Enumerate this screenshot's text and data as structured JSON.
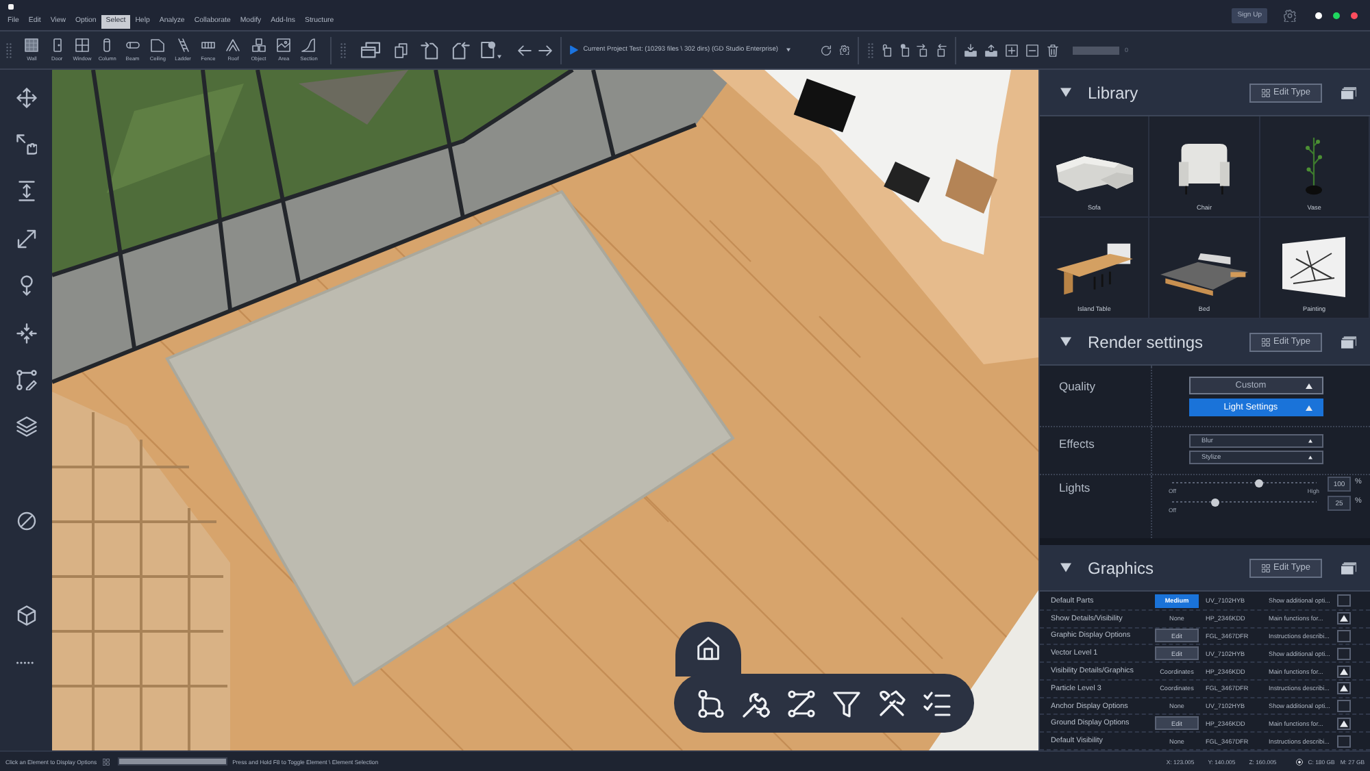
{
  "title_bar": {
    "menu": [
      {
        "label": "File",
        "selected": false
      },
      {
        "label": "Edit",
        "selected": false
      },
      {
        "label": "View",
        "selected": false
      },
      {
        "label": "Option",
        "selected": false
      },
      {
        "label": "Select",
        "selected": true
      },
      {
        "label": "Help",
        "selected": false
      },
      {
        "label": "Analyze",
        "selected": false
      },
      {
        "label": "Collaborate",
        "selected": false
      },
      {
        "label": "Modify",
        "selected": false
      },
      {
        "label": "Add-Ins",
        "selected": false
      },
      {
        "label": "Structure",
        "selected": false
      }
    ],
    "sign_up": "Sign Up",
    "window_controls": [
      {
        "color": "#ffffff"
      },
      {
        "color": "#1fd65f"
      },
      {
        "color": "#ff4d5e"
      }
    ]
  },
  "toolbar": {
    "tools": [
      "Wall",
      "Door",
      "Window",
      "Column",
      "Beam",
      "Ceiling",
      "Ladder",
      "Fence",
      "Roof",
      "Object",
      "Area",
      "Section"
    ],
    "project": "Current Project Test: (10293 files \\ 302 dirs) (GD Studio Enterprise)",
    "zoom_value": "0"
  },
  "library": {
    "title": "Library",
    "edit_type": "Edit Type",
    "items": [
      "Sofa",
      "Chair",
      "Vase",
      "Island Table",
      "Bed",
      "Painting"
    ]
  },
  "render_settings": {
    "title": "Render settings",
    "edit_type": "Edit Type",
    "quality": {
      "label": "Quality",
      "dropdown": "Custom",
      "button": "Light Settings"
    },
    "effects": {
      "label": "Effects",
      "dropdowns": [
        "Blur",
        "Stylize"
      ]
    },
    "lights": {
      "label": "Lights",
      "sliders": [
        {
          "level": 0.6,
          "min_label": "Off",
          "max_label": "High",
          "value": "100",
          "unit": "%"
        },
        {
          "level": 0.3,
          "min_label": "Off",
          "value": "25",
          "unit": "%"
        }
      ]
    }
  },
  "graphics": {
    "title": "Graphics",
    "edit_type": "Edit Type",
    "rows": [
      {
        "name": "Default Parts",
        "value": {
          "kind": "button",
          "label": "Medium",
          "selected": true
        },
        "code": "UV_7102HYB",
        "description": "Show additional opti...",
        "checked": false
      },
      {
        "name": "Show Details/Visibility",
        "value": {
          "kind": "text",
          "label": "None"
        },
        "code": "HP_2346KDD",
        "description": "Main functions for...",
        "checked": true
      },
      {
        "name": "Graphic Display Options",
        "value": {
          "kind": "button",
          "label": "Edit",
          "selected": false
        },
        "code": "FGL_3467DFR",
        "description": "Instructions describi...",
        "checked": false
      },
      {
        "name": "Vector Level 1",
        "value": {
          "kind": "button",
          "label": "Edit",
          "selected": false
        },
        "code": "UV_7102HYB",
        "description": "Show additional opti...",
        "checked": false
      },
      {
        "name": "Visibility Details/Graphics",
        "value": {
          "kind": "text",
          "label": "Coordinates"
        },
        "code": "HP_2346KDD",
        "description": "Main functions for...",
        "checked": true
      },
      {
        "name": "Particle Level 3",
        "value": {
          "kind": "text",
          "label": "Coordinates"
        },
        "code": "FGL_3467DFR",
        "description": "Instructions describi...",
        "checked": true
      },
      {
        "name": "Anchor Display Options",
        "value": {
          "kind": "text",
          "label": "None"
        },
        "code": "UV_7102HYB",
        "description": "Show additional opti...",
        "checked": false
      },
      {
        "name": "Ground Display Options",
        "value": {
          "kind": "button",
          "label": "Edit",
          "selected": false
        },
        "code": "HP_2346KDD",
        "description": "Main functions for...",
        "checked": true
      },
      {
        "name": "Default Visibility",
        "value": {
          "kind": "text",
          "label": "None"
        },
        "code": "FGL_3467DFR",
        "description": "Instructions describi...",
        "checked": false
      }
    ]
  },
  "status_bar": {
    "hint": "Click an Element to Display Options",
    "progress": {
      "level": 1
    },
    "shortcut_hint": "Press and Hold F8 to Toggle Element \\ Element Selection",
    "coords": [
      "X: 123.005",
      "Y: 140.005",
      "Z: 160.005"
    ],
    "memory": [
      "C: 180 GB",
      "M: 27 GB"
    ]
  }
}
